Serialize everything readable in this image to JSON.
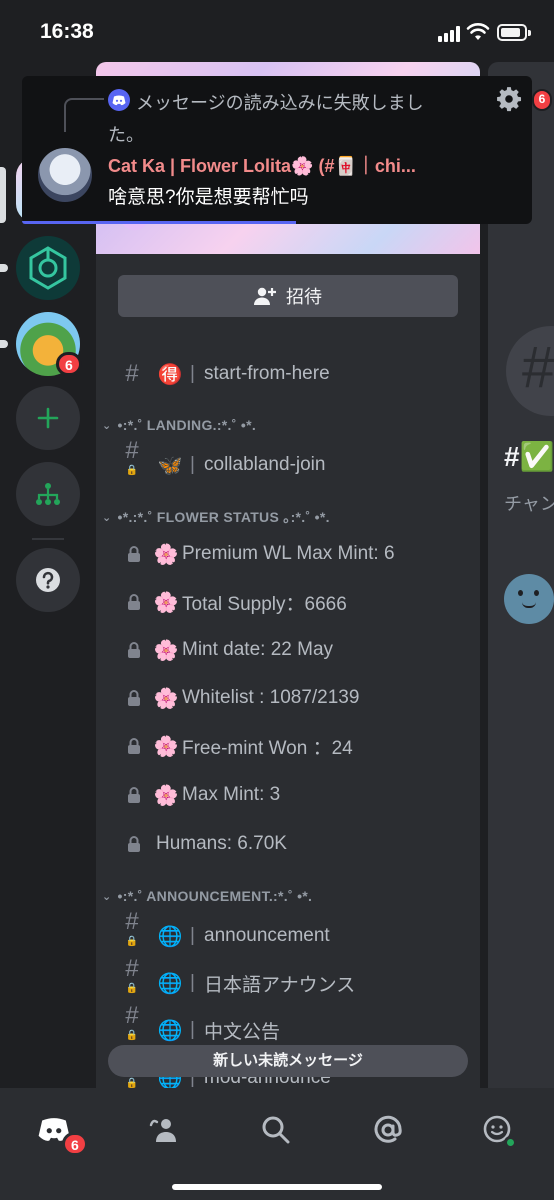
{
  "status_bar": {
    "time": "16:38"
  },
  "servers": [
    {
      "name": "cat-ka-server",
      "badge": ""
    },
    {
      "name": "generic-g-server",
      "badge": ""
    },
    {
      "name": "my-magic-planet-server",
      "badge": "6"
    }
  ],
  "banner": {},
  "invite": {
    "label": "招待"
  },
  "channels": {
    "start": {
      "emoji": "🉐",
      "name": "start-from-here"
    },
    "cat_landing": "•:*.˚ LANDING.:*.˚ •*.",
    "collabland": {
      "emoji": "🦋",
      "name": "collabland-join"
    },
    "cat_status": "•*.:*.˚ FLOWER STATUS ｡:*.˚ •*.",
    "status": [
      {
        "emoji": "🌸",
        "text": " Premium WL Max Mint:  6"
      },
      {
        "emoji": "🌸",
        "text": "Total Supply：6666"
      },
      {
        "emoji": "🌸",
        "text": "Mint date:  22 May"
      },
      {
        "emoji": "🌸",
        "text": "Whitelist : 1087/2139"
      },
      {
        "emoji": "🌸",
        "text": "Free-mint Won ：24"
      },
      {
        "emoji": "🌸",
        "text": " Max Mint:  3"
      }
    ],
    "humans": "Humans: 6.70K",
    "cat_announce": "•:*.˚ ANNOUNCEMENT.:*.˚ •*.",
    "announce": [
      {
        "emoji": "🌐",
        "name": "announcement"
      },
      {
        "emoji": "🌐",
        "name": "日本語アナウンス"
      },
      {
        "emoji": "🌐",
        "name": "中文公告"
      },
      {
        "emoji": "🌐",
        "name": "mod-announce"
      }
    ]
  },
  "unread_pill": "新しい未読メッセージ",
  "right_panel": {
    "hash": "#",
    "channel_start": "#✅",
    "sub": "チャン",
    "badge": "6"
  },
  "notification": {
    "error": "メッセージの読み込みに失敗しました。",
    "author": "Cat Ka | Flower Lolita🌸 (#🀄｜chi...",
    "message": "啥意思?你是想要帮忙吗"
  },
  "tab_bar": {
    "home_badge": "6"
  },
  "colors": {
    "accent": "#5865f2",
    "danger": "#f23f43",
    "bg": "#1e1f22",
    "panel": "#2b2d31",
    "online": "#23a55a"
  }
}
